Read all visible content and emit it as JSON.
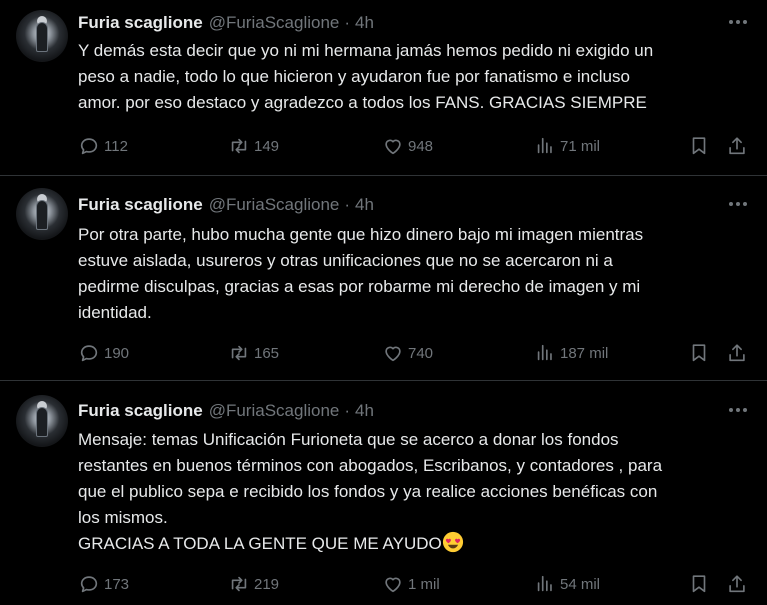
{
  "tweets": [
    {
      "name": "Furia scaglione",
      "handle": "@FuriaScaglione",
      "sep": "·",
      "time": "4h",
      "text": "Y demás esta decir que yo ni mi hermana jamás hemos pedido ni exigido un\npeso a nadie, todo lo que hicieron y ayudaron fue por fanatismo e incluso\namor. por eso destaco y agradezco a todos los FANS. GRACIAS SIEMPRE",
      "replies": "112",
      "retweets": "149",
      "likes": "948",
      "views": "71 mil"
    },
    {
      "name": "Furia scaglione",
      "handle": "@FuriaScaglione",
      "sep": "·",
      "time": "4h",
      "text": "Por otra parte, hubo mucha gente que hizo dinero bajo mi imagen mientras\nestuve aislada, usureros y otras unificaciones que no se acercaron ni a\npedirme disculpas, gracias a esas por robarme mi derecho de imagen y mi\nidentidad.",
      "replies": "190",
      "retweets": "165",
      "likes": "740",
      "views": "187 mil"
    },
    {
      "name": "Furia scaglione",
      "handle": "@FuriaScaglione",
      "sep": "·",
      "time": "4h",
      "text": "Mensaje: temas Unificación Furioneta que se acerco a donar los fondos\nrestantes en buenos términos con abogados, Escribanos, y contadores , para\nque el publico sepa e recibido los fondos y ya realice acciones benéficas con\nlos mismos.\nGRACIAS A TODA LA GENTE QUE ME AYUDO",
      "replies": "173",
      "retweets": "219",
      "likes": "1 mil",
      "views": "54 mil"
    }
  ],
  "icons": {
    "more": "more-dots-icon",
    "reply": "reply-icon",
    "retweet": "retweet-icon",
    "like": "like-icon",
    "views": "views-icon",
    "bookmark": "bookmark-icon",
    "share": "share-icon",
    "emoji": "heart-eyes-emoji"
  },
  "colors": {
    "background": "#000000",
    "text": "#e7e9ea",
    "muted": "#71767b",
    "divider": "#2f3336"
  }
}
